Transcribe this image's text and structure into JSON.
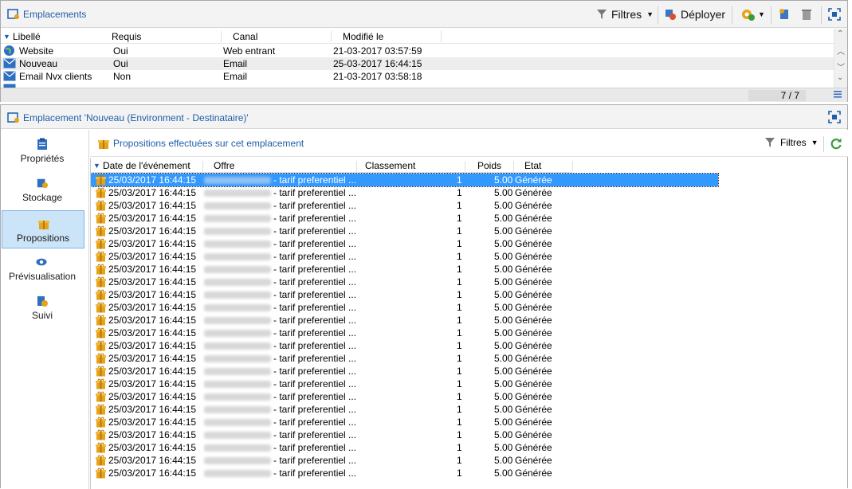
{
  "top_panel": {
    "title": "Emplacements",
    "toolbar": {
      "filters_label": "Filtres",
      "deploy_label": "Déployer"
    },
    "columns": [
      "Libellé",
      "Requis",
      "Canal",
      "Modifié le"
    ],
    "rows": [
      {
        "label": "Website",
        "required": "Oui",
        "channel": "Web entrant",
        "modified": "21-03-2017 03:57:59",
        "icon": "globe-icon"
      },
      {
        "label": "Nouveau",
        "required": "Oui",
        "channel": "Email",
        "modified": "25-03-2017 16:44:15",
        "icon": "email-icon"
      },
      {
        "label": "Email Nvx clients",
        "required": "Non",
        "channel": "Email",
        "modified": "21-03-2017 03:58:18",
        "icon": "email-icon"
      }
    ],
    "count": "7 / 7"
  },
  "bottom_panel": {
    "title": "Emplacement 'Nouveau (Environment - Destinataire)'",
    "nav": [
      {
        "label": "Propriétés",
        "icon": "clipboard-icon"
      },
      {
        "label": "Stockage",
        "icon": "database-icon"
      },
      {
        "label": "Propositions",
        "icon": "gift-icon"
      },
      {
        "label": "Prévisualisation",
        "icon": "eye-icon"
      },
      {
        "label": "Suivi",
        "icon": "tracking-icon"
      }
    ],
    "content_title": "Propositions effectuées sur cet emplacement",
    "filters_label": "Filtres",
    "columns": [
      "Date de l'événement",
      "Offre",
      "Classement",
      "Poids",
      "Etat"
    ],
    "row_template": {
      "date": "25/03/2017 16:44:15",
      "offer": "- tarif preferentiel ...",
      "rank": "1",
      "weight": "5.00",
      "state": "Générée"
    },
    "row_count": 24
  },
  "colors": {
    "accent": "#1f5ea8",
    "selection": "#3399ff",
    "gift": "#e6a21a"
  }
}
